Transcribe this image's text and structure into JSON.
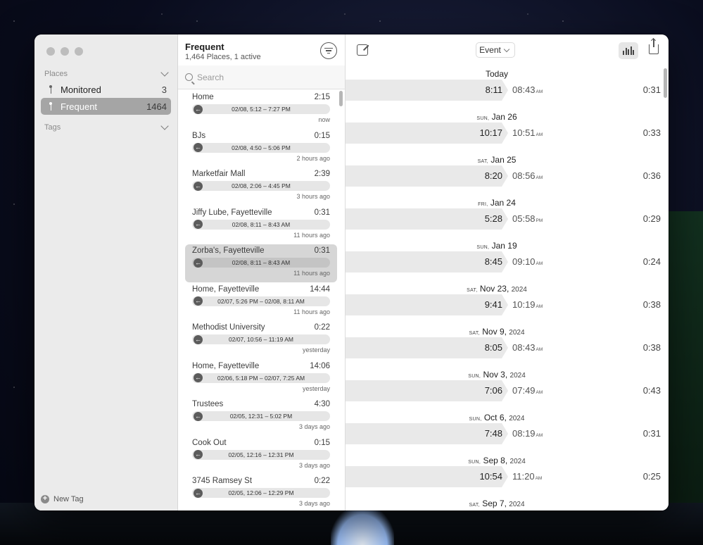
{
  "sidebar": {
    "places_header": "Places",
    "items": [
      {
        "label": "Monitored",
        "count": "3",
        "icon": "pin-icon"
      },
      {
        "label": "Frequent",
        "count": "1464",
        "icon": "pin-icon"
      }
    ],
    "tags_header": "Tags",
    "new_tag_label": "New Tag"
  },
  "list": {
    "title": "Frequent",
    "subtitle": "1,464 Places, 1 active",
    "search_placeholder": "Search",
    "rows": [
      {
        "name": "Home",
        "duration": "2:15",
        "range": "02/08, 5:12 – 7:27 PM",
        "ago": "now"
      },
      {
        "name": "BJs",
        "duration": "0:15",
        "range": "02/08, 4:50 – 5:06 PM",
        "ago": "2 hours ago"
      },
      {
        "name": "Marketfair Mall",
        "duration": "2:39",
        "range": "02/08, 2:06 – 4:45 PM",
        "ago": "3 hours ago"
      },
      {
        "name": "Jiffy Lube, Fayetteville",
        "duration": "0:31",
        "range": "02/08, 8:11 – 8:43 AM",
        "ago": "11 hours ago"
      },
      {
        "name": "Zorba's, Fayetteville",
        "duration": "0:31",
        "range": "02/08, 8:11 – 8:43 AM",
        "ago": "11 hours ago"
      },
      {
        "name": "Home, Fayetteville",
        "duration": "14:44",
        "range": "02/07, 5:26 PM – 02/08, 8:11 AM",
        "ago": "11 hours ago"
      },
      {
        "name": "Methodist University",
        "duration": "0:22",
        "range": "02/07, 10:56 – 11:19 AM",
        "ago": "yesterday"
      },
      {
        "name": "Home, Fayetteville",
        "duration": "14:06",
        "range": "02/06, 5:18 PM – 02/07, 7:25 AM",
        "ago": "yesterday"
      },
      {
        "name": "Trustees",
        "duration": "4:30",
        "range": "02/05, 12:31 – 5:02 PM",
        "ago": "3 days ago"
      },
      {
        "name": "Cook Out",
        "duration": "0:15",
        "range": "02/05, 12:16 – 12:31 PM",
        "ago": "3 days ago"
      },
      {
        "name": "3745 Ramsey St",
        "duration": "0:22",
        "range": "02/05, 12:06 – 12:29 PM",
        "ago": "3 days ago"
      }
    ]
  },
  "toolbar": {
    "event_select": "Event"
  },
  "timeline": [
    {
      "weekday": "",
      "date": "Today",
      "year": "",
      "start": "8:11",
      "end": "08:43",
      "ampm": "AM",
      "dur": "0:31"
    },
    {
      "weekday": "SUN,",
      "date": "Jan 26",
      "year": "",
      "start": "10:17",
      "end": "10:51",
      "ampm": "AM",
      "dur": "0:33"
    },
    {
      "weekday": "SAT,",
      "date": "Jan 25",
      "year": "",
      "start": "8:20",
      "end": "08:56",
      "ampm": "AM",
      "dur": "0:36"
    },
    {
      "weekday": "FRI,",
      "date": "Jan 24",
      "year": "",
      "start": "5:28",
      "end": "05:58",
      "ampm": "PM",
      "dur": "0:29"
    },
    {
      "weekday": "SUN,",
      "date": "Jan 19",
      "year": "",
      "start": "8:45",
      "end": "09:10",
      "ampm": "AM",
      "dur": "0:24"
    },
    {
      "weekday": "SAT,",
      "date": "Nov 23,",
      "year": "2024",
      "start": "9:41",
      "end": "10:19",
      "ampm": "AM",
      "dur": "0:38"
    },
    {
      "weekday": "SAT,",
      "date": "Nov 9,",
      "year": "2024",
      "start": "8:05",
      "end": "08:43",
      "ampm": "AM",
      "dur": "0:38"
    },
    {
      "weekday": "SUN,",
      "date": "Nov 3,",
      "year": "2024",
      "start": "7:06",
      "end": "07:49",
      "ampm": "AM",
      "dur": "0:43"
    },
    {
      "weekday": "SUN,",
      "date": "Oct 6,",
      "year": "2024",
      "start": "7:48",
      "end": "08:19",
      "ampm": "AM",
      "dur": "0:31"
    },
    {
      "weekday": "SUN,",
      "date": "Sep 8,",
      "year": "2024",
      "start": "10:54",
      "end": "11:20",
      "ampm": "AM",
      "dur": "0:25"
    },
    {
      "weekday": "SAT,",
      "date": "Sep 7,",
      "year": "2024",
      "start": "",
      "end": "",
      "ampm": "",
      "dur": ""
    }
  ]
}
